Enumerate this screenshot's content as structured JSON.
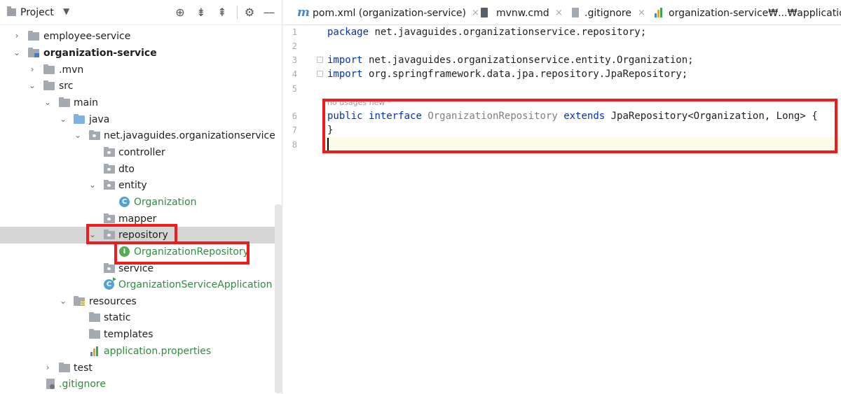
{
  "panel": {
    "title": "Project",
    "caret": "▼",
    "tools": {
      "locate": "⊕",
      "collapse": "⇟",
      "expand": "⇞",
      "settings": "⚙",
      "hide": "—"
    }
  },
  "tree": {
    "items": [
      {
        "label": "employee-service",
        "expanded": false
      },
      {
        "label": "organization-service",
        "expanded": true
      },
      {
        "label": ".mvn",
        "expanded": false
      },
      {
        "label": "src",
        "expanded": true
      },
      {
        "label": "main",
        "expanded": true
      },
      {
        "label": "java",
        "expanded": true
      },
      {
        "label": "net.javaguides.organizationservice",
        "expanded": true
      },
      {
        "label": "controller"
      },
      {
        "label": "dto"
      },
      {
        "label": "entity",
        "expanded": true
      },
      {
        "label": "Organization",
        "badge": "C"
      },
      {
        "label": "mapper"
      },
      {
        "label": "repository",
        "expanded": true,
        "selected": true
      },
      {
        "label": "OrganizationRepository",
        "badge": "I"
      },
      {
        "label": "service"
      },
      {
        "label": "OrganizationServiceApplication",
        "badge": "C"
      },
      {
        "label": "resources",
        "expanded": true
      },
      {
        "label": "static"
      },
      {
        "label": "templates"
      },
      {
        "label": "application.properties"
      },
      {
        "label": "test",
        "expanded": false
      },
      {
        "label": ".gitignore"
      }
    ]
  },
  "tabs": [
    {
      "icon": "m",
      "label": "pom.xml (organization-service)",
      "close": "×"
    },
    {
      "label": "mvnw.cmd",
      "close": "×"
    },
    {
      "label": ".gitignore",
      "close": "×"
    },
    {
      "label": "organization-service₩...₩application.properties"
    }
  ],
  "editor": {
    "line_numbers": [
      "1",
      "2",
      "3",
      "4",
      "5",
      "6",
      "7",
      "8"
    ],
    "hint": "no usages   new *",
    "line1": {
      "kw": "package",
      "rest": " net.javaguides.organizationservice.repository;"
    },
    "line3": {
      "kw": "import",
      "rest": " net.javaguides.organizationservice.entity.Organization;"
    },
    "line4": {
      "kw": "import",
      "rest": " org.springframework.data.jpa.repository.JpaRepository;"
    },
    "line6": {
      "kw1": "public",
      "kw2": "interface",
      "name": "OrganizationRepository",
      "kw3": "extends",
      "rest": " JpaRepository<Organization, Long> {"
    },
    "line7": "}"
  },
  "colors": {
    "highlight": "#ee1c1c",
    "keyword": "#0033b3",
    "green_label": "#2f8c3f",
    "selection": "#d5d5d5"
  }
}
